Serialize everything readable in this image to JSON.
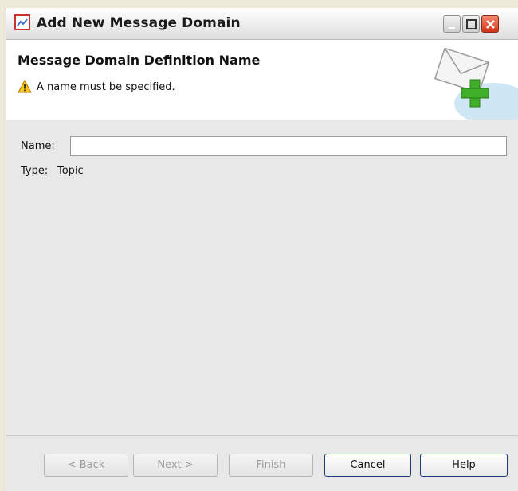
{
  "window": {
    "title": "Add New Message Domain",
    "controls": {
      "minimize_icon": "minimize-icon",
      "maximize_icon": "maximize-icon",
      "close_icon": "close-icon"
    }
  },
  "banner": {
    "title": "Message Domain Definition Name",
    "message": "A name must be specified.",
    "warning_icon": "warning-icon",
    "graphic_icon": "envelope-add-icon"
  },
  "form": {
    "name_label": "Name:",
    "name_value": "",
    "type_label": "Type:",
    "type_value": "Topic"
  },
  "buttons": {
    "back": {
      "label": "< Back",
      "enabled": false
    },
    "next": {
      "label": "Next >",
      "enabled": false
    },
    "finish": {
      "label": "Finish",
      "enabled": false
    },
    "cancel": {
      "label": "Cancel",
      "enabled": true
    },
    "help": {
      "label": "Help",
      "enabled": true
    }
  },
  "colors": {
    "close_button": "#d0341a",
    "warning": "#f5c518",
    "plus": "#3fae29"
  }
}
